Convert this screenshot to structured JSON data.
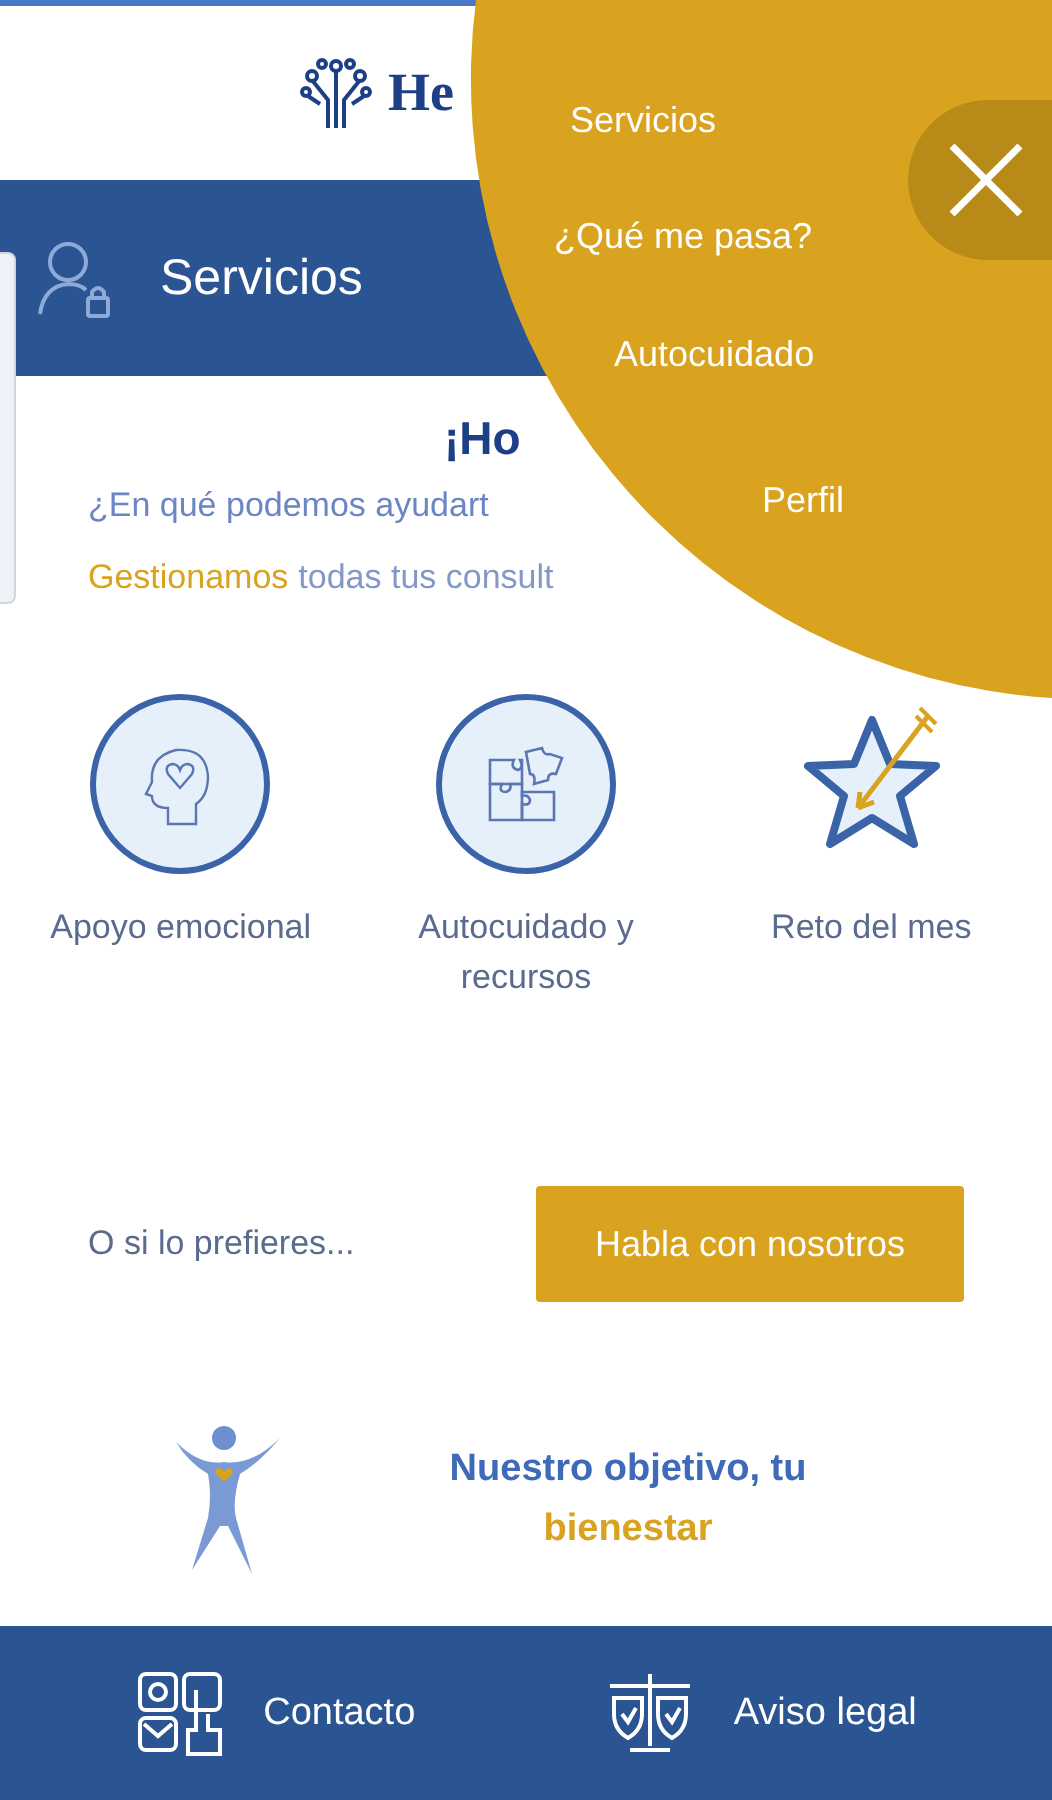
{
  "header": {
    "logo_text": "He"
  },
  "nav_bar": {
    "title": "Servicios"
  },
  "greeting": {
    "title": "¡Ho",
    "question": "¿En qué podemos ayudart",
    "tagline": [
      {
        "text": "Gestionamos",
        "color": "#d9a21f"
      },
      {
        "text": "todas tus consult",
        "color": "#8498c8"
      }
    ]
  },
  "services": [
    {
      "label": "Apoyo emocional",
      "kind": "head"
    },
    {
      "label": "Autocuidado y recursos",
      "kind": "puzzle"
    },
    {
      "label": "Reto del mes",
      "kind": "star"
    }
  ],
  "contact": {
    "prompt": "O si lo prefieres...",
    "button": "Habla con nosotros"
  },
  "mission": {
    "line": "Nuestro objetivo, tu",
    "highlight": "bienestar"
  },
  "footer": [
    {
      "label": "Contacto",
      "kind": "contact"
    },
    {
      "label": "Aviso legal",
      "kind": "legal"
    }
  ],
  "menu": {
    "items": [
      {
        "label": "Servicios"
      },
      {
        "label": "¿Qué me pasa?"
      },
      {
        "label": "Autocuidado"
      },
      {
        "label": "Perfil"
      }
    ]
  }
}
